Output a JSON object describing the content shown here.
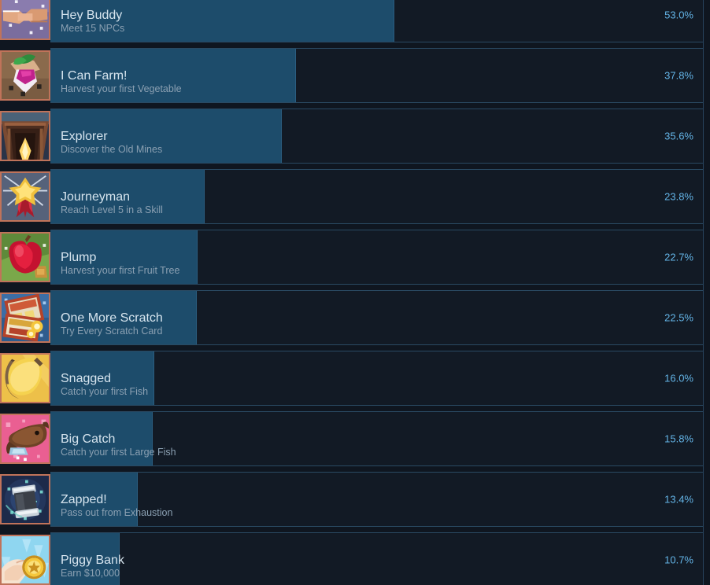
{
  "theme": {
    "page_bg": "#0f1620",
    "row_bg": "#121a25",
    "bar_fill": "#1d4c6b",
    "bar_edge": "#2a5d80",
    "row_border": "#2a4a63",
    "name_color": "#d6e4ee",
    "desc_color": "#8ba0b2",
    "percent_color": "#64b5e8",
    "icon_frame": "#c0735a"
  },
  "achievements": [
    {
      "name": "Hey Buddy",
      "description": "Meet 15 NPCs",
      "percent": "53.0%",
      "percent_value": 53.0,
      "icon": "handshake-icon"
    },
    {
      "name": "I Can Farm!",
      "description": "Harvest your first Vegetable",
      "percent": "37.8%",
      "percent_value": 37.8,
      "icon": "turnip-harvest-icon"
    },
    {
      "name": "Explorer",
      "description": "Discover the Old Mines",
      "percent": "35.6%",
      "percent_value": 35.6,
      "icon": "mine-entrance-icon"
    },
    {
      "name": "Journeyman",
      "description": "Reach Level 5 in a Skill",
      "percent": "23.8%",
      "percent_value": 23.8,
      "icon": "award-ribbon-icon"
    },
    {
      "name": "Plump",
      "description": "Harvest your first Fruit Tree",
      "percent": "22.7%",
      "percent_value": 22.7,
      "icon": "red-apple-icon"
    },
    {
      "name": "One More Scratch",
      "description": "Try Every Scratch Card",
      "percent": "22.5%",
      "percent_value": 22.5,
      "icon": "scratch-card-icon"
    },
    {
      "name": "Snagged",
      "description": "Catch your first Fish",
      "percent": "16.0%",
      "percent_value": 16.0,
      "icon": "fishing-hook-icon"
    },
    {
      "name": "Big Catch",
      "description": "Catch your first Large Fish",
      "percent": "15.8%",
      "percent_value": 15.8,
      "icon": "big-fish-icon"
    },
    {
      "name": "Zapped!",
      "description": "Pass out from Exhaustion",
      "percent": "13.4%",
      "percent_value": 13.4,
      "icon": "battery-icon"
    },
    {
      "name": "Piggy Bank",
      "description": "Earn $10,000",
      "percent": "10.7%",
      "percent_value": 10.7,
      "icon": "gold-coin-hand-icon"
    }
  ]
}
